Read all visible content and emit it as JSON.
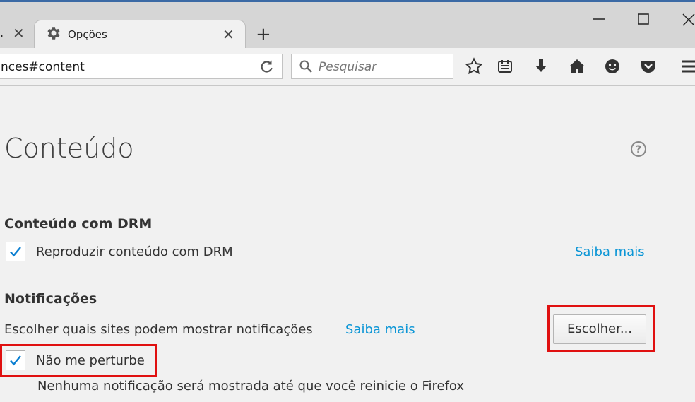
{
  "tabs": {
    "previous_tab_ellipsis": ".",
    "active_tab_title": "Opções",
    "close_glyph": "✕",
    "new_tab_glyph": "+"
  },
  "window_controls": {
    "minimize": "minimize-icon",
    "maximize": "maximize-icon",
    "close": "close-icon"
  },
  "navbar": {
    "url": "nces#content",
    "search_placeholder": "Pesquisar",
    "icons": [
      "bookmark-star-icon",
      "reading-list-icon",
      "download-icon",
      "home-icon",
      "emoji-icon",
      "pocket-icon",
      "menu-icon"
    ]
  },
  "page": {
    "title": "Conteúdo",
    "drm": {
      "heading": "Conteúdo com DRM",
      "checkbox_label": "Reproduzir conteúdo com DRM",
      "checked": true,
      "learn_more": "Saiba mais"
    },
    "notifications": {
      "heading": "Notificações",
      "description": "Escolher quais sites podem mostrar notificações",
      "learn_more": "Saiba mais",
      "choose_button": "Escolher...",
      "dnd_label": "Não me perturbe",
      "dnd_checked": true,
      "dnd_hint": "Nenhuma notificação será mostrada até que você reinicie o Firefox"
    }
  },
  "colors": {
    "accent_link": "#0c96d6",
    "highlight": "#e01010",
    "check": "#0b7fd1",
    "window_border": "#3b6aa5"
  }
}
